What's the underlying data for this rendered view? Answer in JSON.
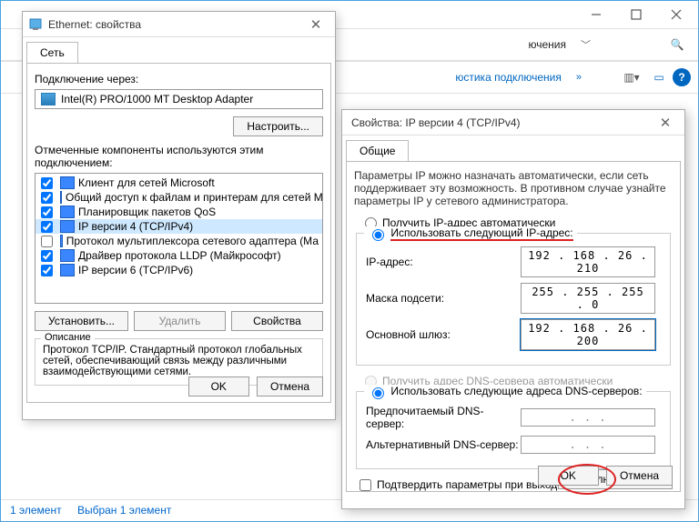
{
  "explorer": {
    "toolbar_label_connections": "ючения",
    "toolbar_label_diagnostics": "юстика подключения",
    "status_left": "1 элемент",
    "status_right": "Выбран 1 элемент"
  },
  "ethernet": {
    "title": "Ethernet: свойства",
    "tab": "Сеть",
    "connect_via_label": "Подключение через:",
    "adapter": "Intel(R) PRO/1000 MT Desktop Adapter",
    "configure_btn": "Настроить...",
    "components_label": "Отмеченные компоненты используются этим подключением:",
    "components": [
      {
        "checked": true,
        "label": "Клиент для сетей Microsoft"
      },
      {
        "checked": true,
        "label": "Общий доступ к файлам и принтерам для сетей Mi"
      },
      {
        "checked": true,
        "label": "Планировщик пакетов QoS"
      },
      {
        "checked": true,
        "label": "IP версии 4 (TCP/IPv4)",
        "selected": true
      },
      {
        "checked": false,
        "label": "Протокол мультиплексора сетевого адаптера (Ма"
      },
      {
        "checked": true,
        "label": "Драйвер протокола LLDP (Майкрософт)"
      },
      {
        "checked": true,
        "label": "IP версии 6 (TCP/IPv6)"
      }
    ],
    "install_btn": "Установить...",
    "remove_btn": "Удалить",
    "props_btn": "Свойства",
    "desc_legend": "Описание",
    "desc_text": "Протокол TCP/IP. Стандартный протокол глобальных сетей, обеспечивающий связь между различными взаимодействующими сетями.",
    "ok": "OK",
    "cancel": "Отмена"
  },
  "ipv4": {
    "title": "Свойства: IP версии 4 (TCP/IPv4)",
    "tab": "Общие",
    "info": "Параметры IP можно назначать автоматически, если сеть поддерживает эту возможность. В противном случае узнайте параметры IP у сетевого администратора.",
    "r_auto_ip": "Получить IP-адрес автоматически",
    "r_manual_ip": "Использовать следующий IP-адрес:",
    "f_ip_label": "IP-адрес:",
    "f_ip_val": "192 . 168 .  26 . 210",
    "f_mask_label": "Маска подсети:",
    "f_mask_val": "255 . 255 . 255 .  0",
    "f_gw_label": "Основной шлюз:",
    "f_gw_val": "192 . 168 .  26 . 200",
    "r_auto_dns": "Получить адрес DNS-сервера автоматически",
    "r_manual_dns": "Использовать следующие адреса DNS-серверов:",
    "f_dns1_label": "Предпочитаемый DNS-сервер:",
    "f_dns1_val": ".       .       .",
    "f_dns2_label": "Альтернативный DNS-сервер:",
    "f_dns2_val": ".       .       .",
    "confirm_chk": "Подтвердить параметры при выходе",
    "advanced_btn": "Дополнительно...",
    "ok": "OK",
    "cancel": "Отмена"
  }
}
